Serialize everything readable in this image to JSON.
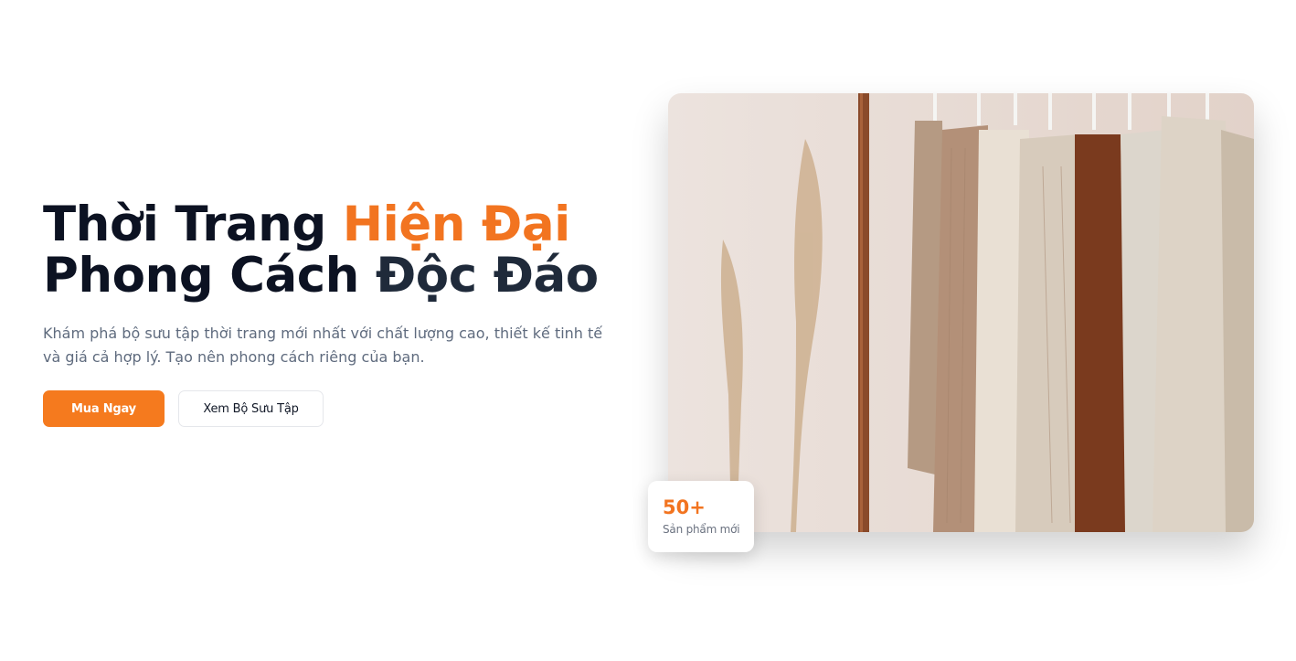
{
  "hero": {
    "title_line1_part1": "Thời Trang ",
    "title_line1_accent": "Hiện Đại",
    "title_line2_part1": "Phong Cách ",
    "title_line2_part2": "Độc Đáo",
    "description": "Khám phá bộ sưu tập thời trang mới nhất với chất lượng cao, thiết kế tinh tế và giá cả hợp lý. Tạo nên phong cách riêng của bạn.",
    "primary_button": "Mua Ngay",
    "secondary_button": "Xem Bộ Sưu Tập",
    "image_subject": "clothing-rack-photo",
    "stat": {
      "value": "50+",
      "label": "Sản phẩm mới"
    }
  },
  "colors": {
    "accent": "#f57a1e",
    "heading": "#0c1222",
    "body_text": "#5f6b7e"
  }
}
